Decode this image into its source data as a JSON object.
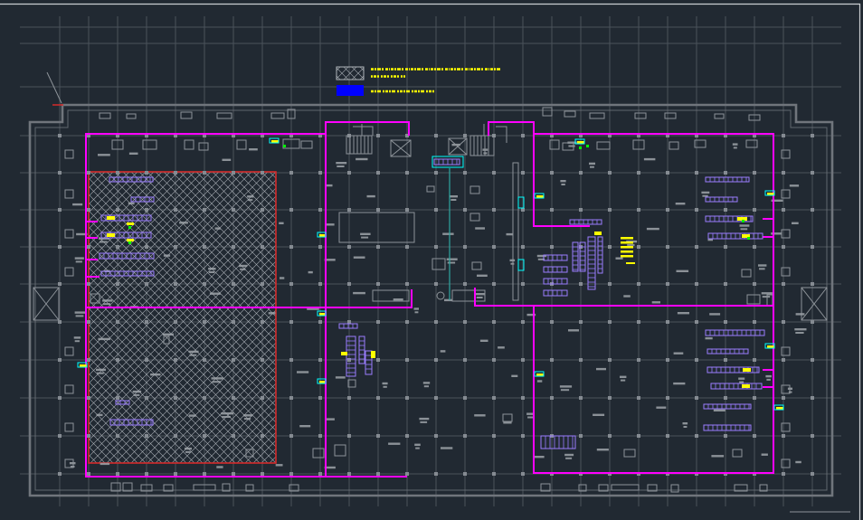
{
  "viewport": {
    "background": "#212932",
    "frame": "#c9cdd1"
  },
  "palette": {
    "grid": "#4a525b",
    "column": "#858b92",
    "label": "#9da3a9",
    "wall": "#70757c",
    "zone_boundary": "#ff00ff",
    "hatch_border": "#d42a2a",
    "hatch_lines": "#aab0b6",
    "equipment": "#9a7dff",
    "annotation_yellow": "#ffff00",
    "annotation_cyan": "#00ffff",
    "annotation_green": "#00ff00",
    "legend_blue": "#0000ff",
    "service_line": "#2fa7a1"
  },
  "legend": {
    "items": [
      {
        "swatch_icon": "crosshatch-swatch-icon",
        "text_color": "#ffff00"
      },
      {
        "swatch_icon": "solid-blue-swatch-icon",
        "text_color": "#ffff00"
      }
    ]
  }
}
